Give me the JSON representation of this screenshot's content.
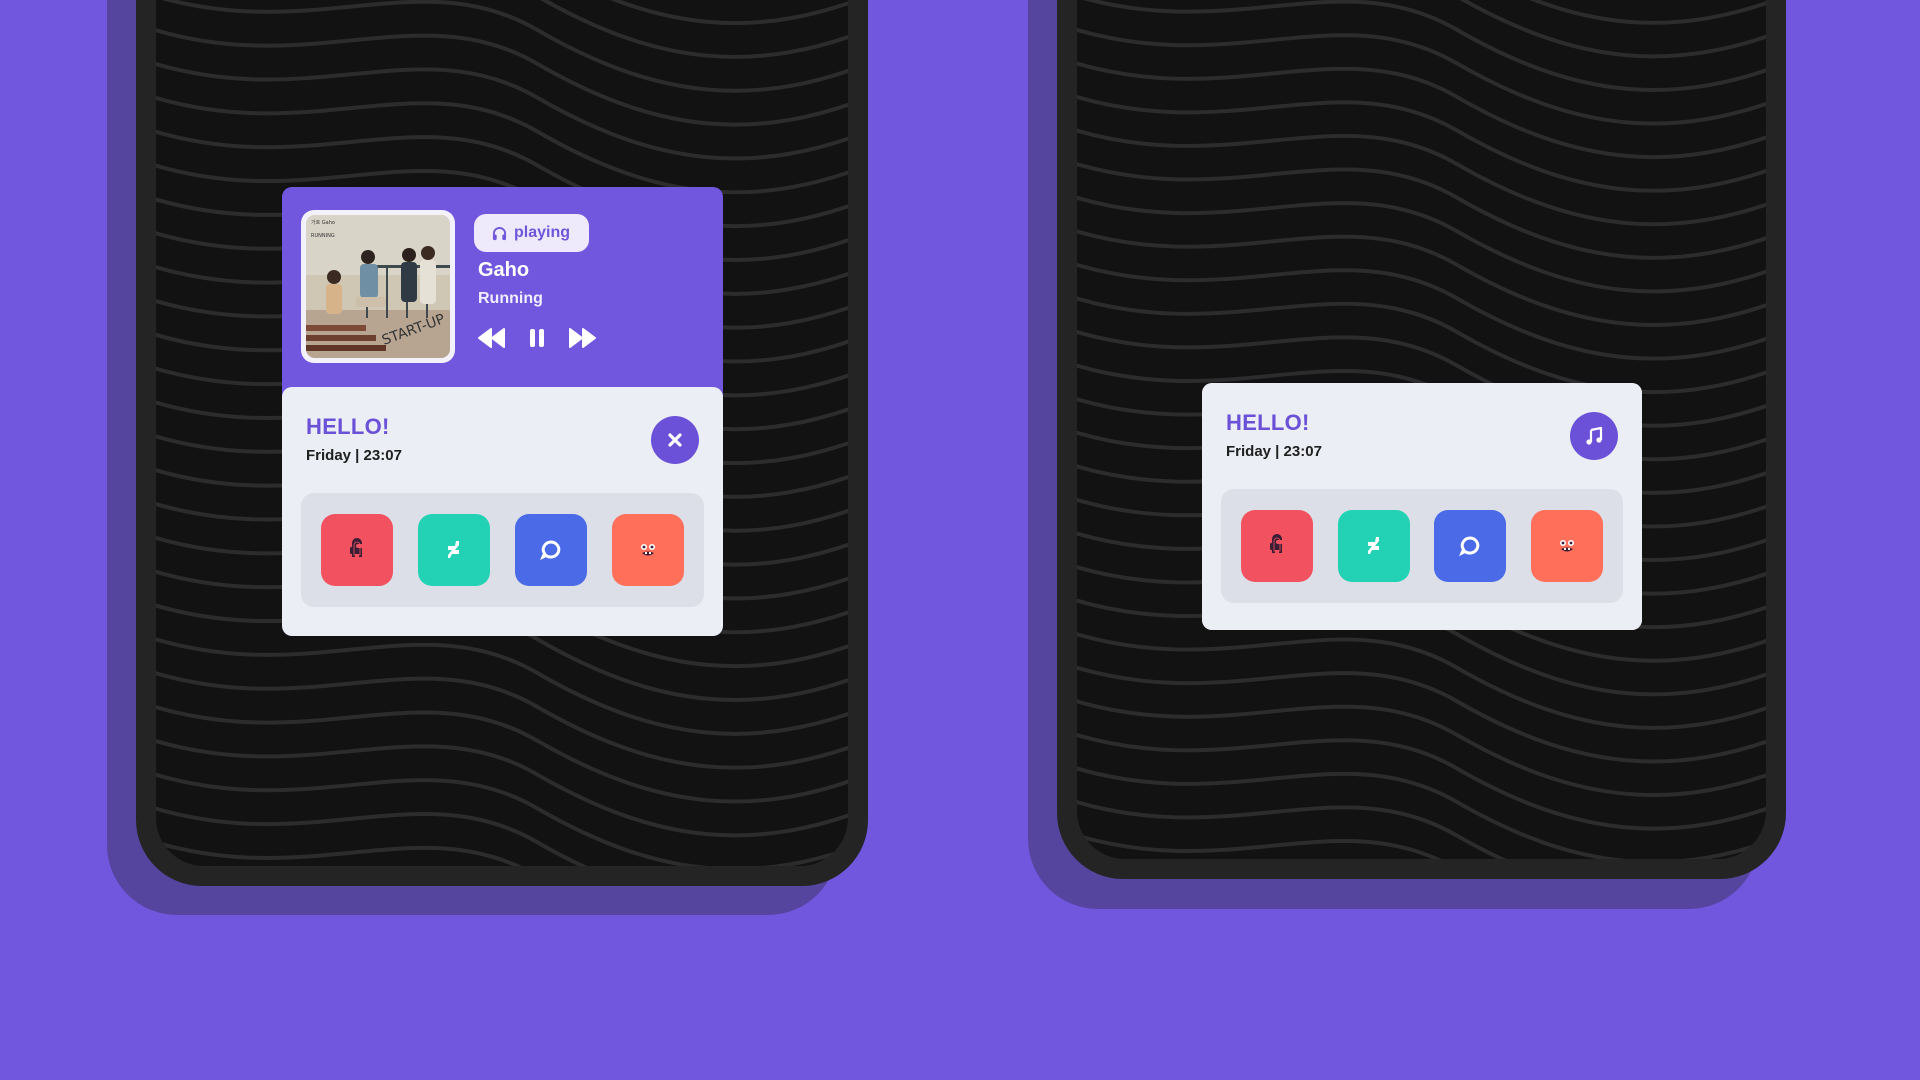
{
  "colors": {
    "background": "#7157DE",
    "accent": "#6B51D8",
    "panel": "#EBEEF4",
    "app_tray": "#DCDFE8",
    "phone_body": "#242424",
    "phone_shadow": "#55459E"
  },
  "music_widget": {
    "status_label": "playing",
    "status_icon": "headphones-icon",
    "artist": "Gaho",
    "track": "Running",
    "album_art": {
      "title_text": "START-UP",
      "small_label": "RUNNING",
      "artist_label": "가호 Gaho"
    },
    "controls": [
      "rewind-icon",
      "pause-icon",
      "fast-forward-icon"
    ]
  },
  "greeting_left": {
    "title": "HELLO!",
    "datetime": "Friday | 23:07",
    "action_icon": "close-icon"
  },
  "greeting_right": {
    "title": "HELLO!",
    "datetime": "Friday | 23:07",
    "action_icon": "music-note-icon"
  },
  "apps": [
    {
      "name": "among-us-app",
      "icon": "among-us-icon",
      "color": "#F2525F"
    },
    {
      "name": "deviantart-app",
      "icon": "deviantart-icon",
      "color": "#23D2B5"
    },
    {
      "name": "messenger-app",
      "icon": "chat-bubble-icon",
      "color": "#4A6AE8"
    },
    {
      "name": "monster-app",
      "icon": "monster-face-icon",
      "color": "#FF6F5A"
    }
  ]
}
